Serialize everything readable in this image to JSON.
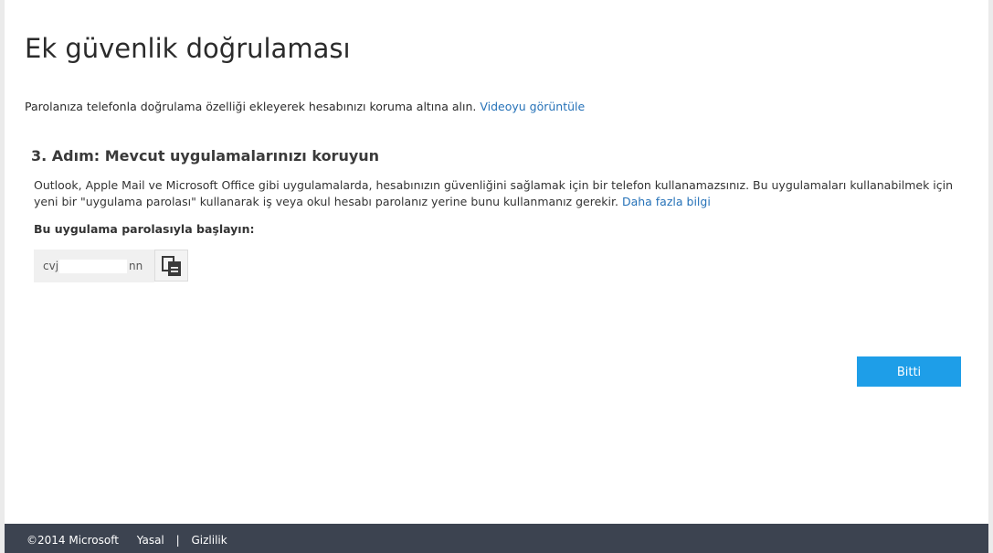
{
  "page": {
    "title": "Ek güvenlik doğrulaması",
    "intro_text": "Parolanıza telefonla doğrulama özelliği ekleyerek hesabınızı koruma altına alın.",
    "intro_link": "Videoyu görüntüle"
  },
  "step": {
    "title": "3. Adım: Mevcut uygulamalarınızı koruyun",
    "description": "Outlook, Apple Mail ve Microsoft Office gibi uygulamalarda, hesabınızın güvenliğini sağlamak için bir telefon kullanamazsınız. Bu uygulamaları kullanabilmek için yeni bir \"uygulama parolası\" kullanarak iş veya okul hesabı parolanız yerine bunu kullanmanız gerekir.",
    "description_link": "Daha fazla bilgi",
    "start_label": "Bu uygulama parolasıyla başlayın:",
    "password_prefix": "cvj",
    "password_suffix": "nn",
    "copy_icon": "copy-icon"
  },
  "actions": {
    "done_label": "Bitti",
    "done_color": "#1e9ee8"
  },
  "footer": {
    "copyright": "©2014 Microsoft",
    "legal": "Yasal",
    "separator": "|",
    "privacy": "Gizlilik",
    "background": "#3c4350"
  }
}
